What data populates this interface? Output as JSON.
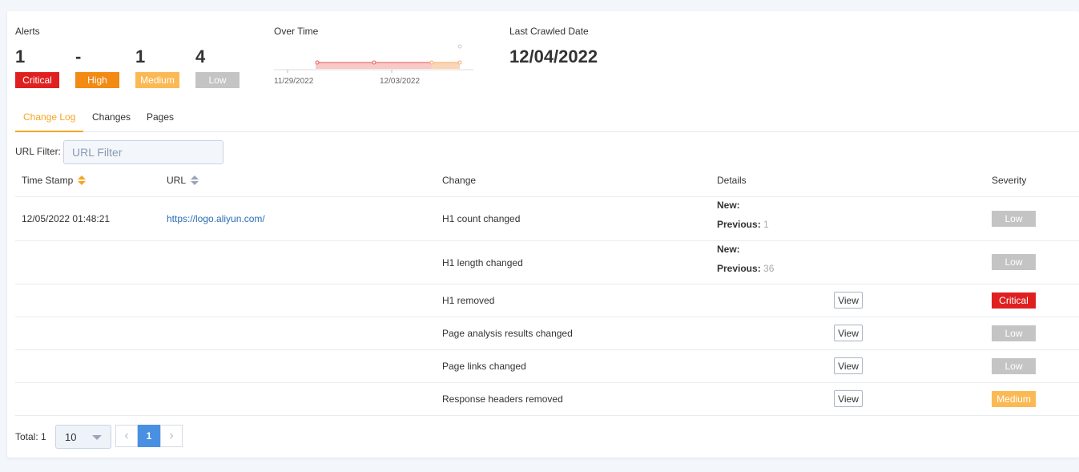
{
  "alerts": {
    "title": "Alerts",
    "counts": [
      {
        "value": "1",
        "label": "Critical",
        "color": "#e02020"
      },
      {
        "value": "-",
        "label": "High",
        "color": "#f28a13"
      },
      {
        "value": "1",
        "label": "Medium",
        "color": "#fbb954"
      },
      {
        "value": "4",
        "label": "Low",
        "color": "#c4c4c4"
      }
    ]
  },
  "over_time": {
    "title": "Over Time",
    "chart_data": {
      "type": "area",
      "x": [
        "11/29/2022",
        "12/03/2022"
      ],
      "xticks": [
        "11/29/2022",
        "12/03/2022"
      ],
      "series": [
        {
          "color": "#e05a5a",
          "fill": "#f9c9c6"
        },
        {
          "color": "#f5a96b",
          "fill": "#fbd6b6"
        }
      ],
      "grid": false
    }
  },
  "last_crawled": {
    "title": "Last Crawled Date",
    "value": "12/04/2022"
  },
  "tabs": [
    {
      "label": "Change Log",
      "active": true
    },
    {
      "label": "Changes",
      "active": false
    },
    {
      "label": "Pages",
      "active": false
    }
  ],
  "filter": {
    "label": "URL Filter:",
    "placeholder": "URL Filter"
  },
  "table": {
    "columns": [
      "Time Stamp",
      "URL",
      "Change",
      "Details",
      "Severity"
    ],
    "rows": [
      {
        "timestamp": "12/05/2022 01:48:21",
        "url": "https://logo.aliyun.com/",
        "change": "H1 count changed",
        "new_label": "New:",
        "prev_label": "Previous:",
        "prev_value": "1",
        "severity": "Low"
      },
      {
        "timestamp": "",
        "url": "",
        "change": "H1 length changed",
        "new_label": "New:",
        "prev_label": "Previous:",
        "prev_value": "36",
        "severity": "Low"
      },
      {
        "timestamp": "",
        "url": "",
        "change": "H1 removed",
        "view": "View",
        "severity": "Critical"
      },
      {
        "timestamp": "",
        "url": "",
        "change": "Page analysis results changed",
        "view": "View",
        "severity": "Low"
      },
      {
        "timestamp": "",
        "url": "",
        "change": "Page links changed",
        "view": "View",
        "severity": "Low"
      },
      {
        "timestamp": "",
        "url": "",
        "change": "Response headers removed",
        "view": "View",
        "severity": "Medium"
      }
    ]
  },
  "pagination": {
    "total_label": "Total: 1",
    "page_size": "10",
    "current_page": "1",
    "prev_icon": "chevron-left-icon",
    "next_icon": "chevron-right-icon"
  },
  "colors": {
    "accent": "#f5a623",
    "critical": "#e02020",
    "high": "#f28a13",
    "medium": "#fbb954",
    "low": "#c4c4c4",
    "link": "#2a6db5",
    "page_active": "#4a90e2"
  }
}
